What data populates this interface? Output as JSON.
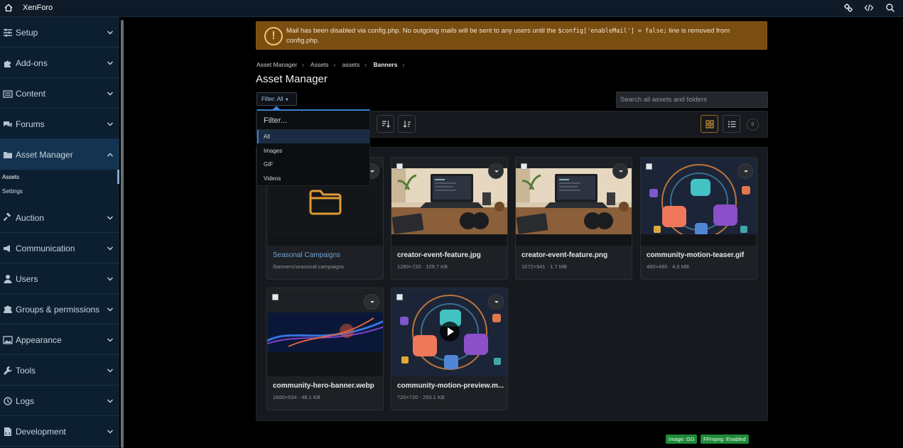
{
  "topbar": {
    "brand": "XenForo",
    "icons": [
      "home-icon",
      "cog-sliders-icon",
      "code-icon",
      "search-icon"
    ]
  },
  "sidebar": {
    "groups": [
      {
        "label": "Setup",
        "icon": "sliders-icon"
      },
      {
        "label": "Add-ons",
        "icon": "puzzle-icon"
      },
      {
        "label": "Content",
        "icon": "content-icon"
      },
      {
        "label": "Forums",
        "icon": "comments-icon"
      },
      {
        "label": "Asset Manager",
        "icon": "folder-icon"
      },
      {
        "label": "Auction",
        "icon": "gavel-icon"
      },
      {
        "label": "Communication",
        "icon": "megaphone-icon"
      },
      {
        "label": "Users",
        "icon": "user-icon"
      },
      {
        "label": "Groups & permissions",
        "icon": "users-icon"
      },
      {
        "label": "Appearance",
        "icon": "image-icon"
      },
      {
        "label": "Tools",
        "icon": "wrench-icon"
      },
      {
        "label": "Logs",
        "icon": "history-icon"
      },
      {
        "label": "Development",
        "icon": "dev-file-icon"
      }
    ],
    "subitems": [
      "Assets",
      "Settings"
    ]
  },
  "notice": {
    "text_before": "Mail has been disabled via config.php. No outgoing mails will be sent to any users until the ",
    "code": "$config['enableMail'] = false;",
    "text_after": " line is removed from config.php."
  },
  "breadcrumb": [
    "Asset Manager",
    "Assets",
    "assets",
    "Banners"
  ],
  "page_title": "Asset Manager",
  "filter_button": "Filter: All",
  "search_placeholder": "Search all assets and folders",
  "toolbar": {
    "count": "0"
  },
  "filter_menu": {
    "title": "Filter...",
    "options": [
      "All",
      "Images",
      "GIF",
      "Videos"
    ],
    "selected": "All"
  },
  "assets": [
    {
      "name": "Seasonal Campaigns",
      "meta": "/banners/seasonal-campaigns",
      "type": "folder"
    },
    {
      "name": "creator-event-feature.jpg",
      "meta": "1280×720 · 109.7 KB",
      "type": "desk"
    },
    {
      "name": "creator-event-feature.png",
      "meta": "1672×941 · 1.7 MB",
      "type": "desk"
    },
    {
      "name": "community-motion-teaser.gif",
      "meta": "480×480 · 4.6 MB",
      "type": "community"
    },
    {
      "name": "community-hero-banner.webp",
      "meta": "1600×534 · 48.1 KB",
      "type": "wave"
    },
    {
      "name": "community-motion-preview.m...",
      "meta": "720×720 · 293.1 KB",
      "type": "video"
    }
  ],
  "footer_badges": [
    "Image: GD",
    "FFmpeg: Enabled"
  ]
}
